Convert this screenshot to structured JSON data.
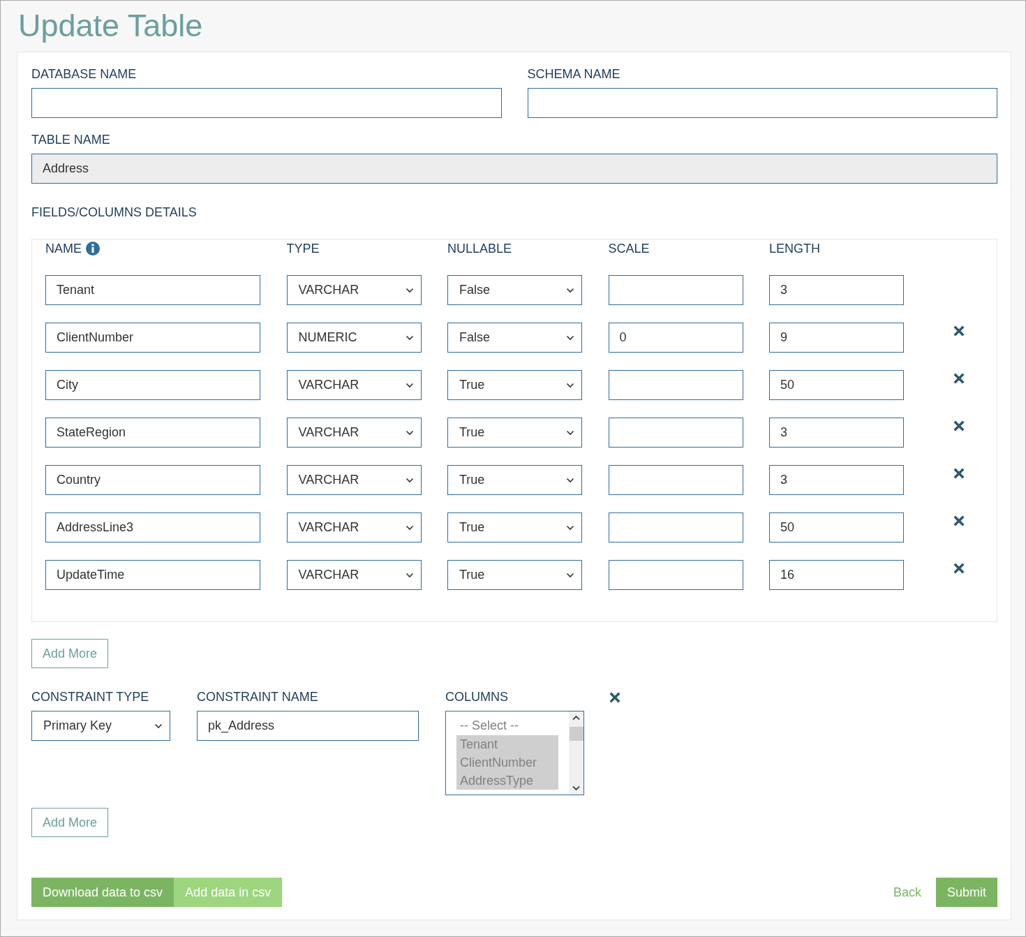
{
  "title": "Update Table",
  "database_name": {
    "label": "DATABASE NAME"
  },
  "schema_name": {
    "label": "SCHEMA NAME"
  },
  "table_name": {
    "label": "TABLE NAME",
    "value": "Address",
    "disabled": true
  },
  "fields_heading": "FIELDS/COLUMNS DETAILS",
  "field_columns": [
    "NAME",
    "TYPE",
    "NULLABLE",
    "SCALE",
    "LENGTH"
  ],
  "fields": [
    {
      "name": "Tenant",
      "type": "VARCHAR",
      "nullable": "False",
      "length": "3",
      "removable": false
    },
    {
      "name": "ClientNumber",
      "type": "NUMERIC",
      "nullable": "False",
      "scale": "0",
      "length": "9",
      "removable": true
    },
    {
      "name": "City",
      "type": "VARCHAR",
      "nullable": "True",
      "length": "50",
      "removable": true
    },
    {
      "name": "StateRegion",
      "type": "VARCHAR",
      "nullable": "True",
      "length": "3",
      "removable": true
    },
    {
      "name": "Country",
      "type": "VARCHAR",
      "nullable": "True",
      "length": "3",
      "removable": true
    },
    {
      "name": "AddressLine3",
      "type": "VARCHAR",
      "nullable": "True",
      "length": "50",
      "removable": true
    },
    {
      "name": "UpdateTime",
      "type": "VARCHAR",
      "nullable": "True",
      "length": "16",
      "removable": true
    }
  ],
  "add_more_fields": "Add More",
  "constraint": {
    "type_label": "CONSTRAINT TYPE",
    "type": "Primary Key",
    "name_label": "CONSTRAINT NAME",
    "name": "pk_Address",
    "columns_label": "COLUMNS",
    "options": [
      {
        "label": "-- Select --",
        "selected": false
      },
      {
        "label": "Tenant",
        "selected": true
      },
      {
        "label": "ClientNumber",
        "selected": true
      },
      {
        "label": "AddressType",
        "selected": true
      }
    ]
  },
  "add_more_constraints": "Add More",
  "buttons": {
    "download": "Download data to csv",
    "add_data": "Add data in csv",
    "back": "Back",
    "submit": "Submit"
  }
}
